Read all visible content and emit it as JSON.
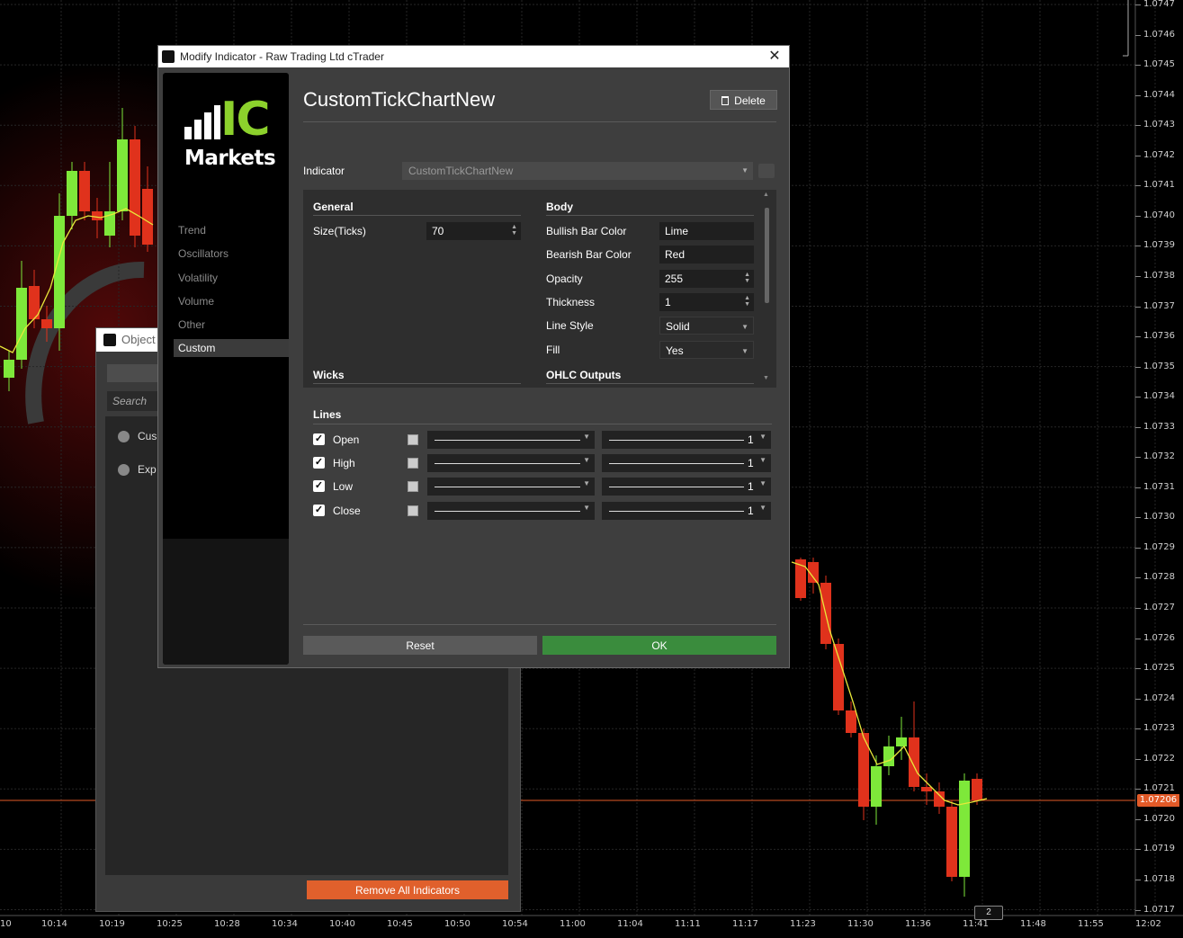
{
  "chart": {
    "price_axis": [
      "1.0747",
      "1.0746",
      "1.0745",
      "1.0744",
      "1.0743",
      "1.0742",
      "1.0741",
      "1.0740",
      "1.0739",
      "1.0738",
      "1.0737",
      "1.0736",
      "1.0735",
      "1.0734",
      "1.0733",
      "1.0732",
      "1.0731",
      "1.0730",
      "1.0729",
      "1.0728",
      "1.0727",
      "1.0726",
      "1.0725",
      "1.0724",
      "1.0723",
      "1.0722",
      "1.0721",
      "1.0720",
      "1.0719",
      "1.0718",
      "1.0717"
    ],
    "current_price": "1.07206",
    "time_axis": [
      "10",
      "10:14",
      "10:19",
      "10:25",
      "10:28",
      "10:34",
      "10:40",
      "10:45",
      "10:50",
      "10:54",
      "11:00",
      "11:04",
      "11:11",
      "11:17",
      "11:23",
      "11:30",
      "11:36",
      "11:41",
      "11:48",
      "11:55",
      "12:02"
    ],
    "bar_count_badge": "2",
    "colors": {
      "bull": "#7ee83a",
      "bear": "#e0321c",
      "ma": "#e8e83a",
      "price_line": "#e25a28"
    }
  },
  "object_manager": {
    "title": "Object",
    "search_placeholder": "Search",
    "items": [
      "Cus",
      "Exp"
    ],
    "remove_all_label": "Remove All Indicators"
  },
  "dialog": {
    "title": "Modify Indicator - Raw Trading Ltd cTrader",
    "close_glyph": "✕",
    "brand": {
      "ic": "IC",
      "markets": "Markets"
    },
    "categories": [
      "Trend",
      "Oscillators",
      "Volatility",
      "Volume",
      "Other",
      "Custom"
    ],
    "active_category": "Custom",
    "indicator_name": "CustomTickChartNew",
    "delete_label": "Delete",
    "indicator_label": "Indicator",
    "indicator_value": "CustomTickChartNew",
    "general": {
      "title": "General",
      "size_label": "Size(Ticks)",
      "size_value": "70"
    },
    "body": {
      "title": "Body",
      "bullish_label": "Bullish Bar Color",
      "bullish_value": "Lime",
      "bearish_label": "Bearish Bar Color",
      "bearish_value": "Red",
      "opacity_label": "Opacity",
      "opacity_value": "255",
      "thickness_label": "Thickness",
      "thickness_value": "1",
      "linestyle_label": "Line Style",
      "linestyle_value": "Solid",
      "fill_label": "Fill",
      "fill_value": "Yes"
    },
    "wicks_title": "Wicks",
    "ohlc_title": "OHLC Outputs",
    "lines": {
      "title": "Lines",
      "rows": [
        {
          "label": "Open",
          "thickness": "1"
        },
        {
          "label": "High",
          "thickness": "1"
        },
        {
          "label": "Low",
          "thickness": "1"
        },
        {
          "label": "Close",
          "thickness": "1"
        }
      ]
    },
    "reset_label": "Reset",
    "ok_label": "OK"
  }
}
